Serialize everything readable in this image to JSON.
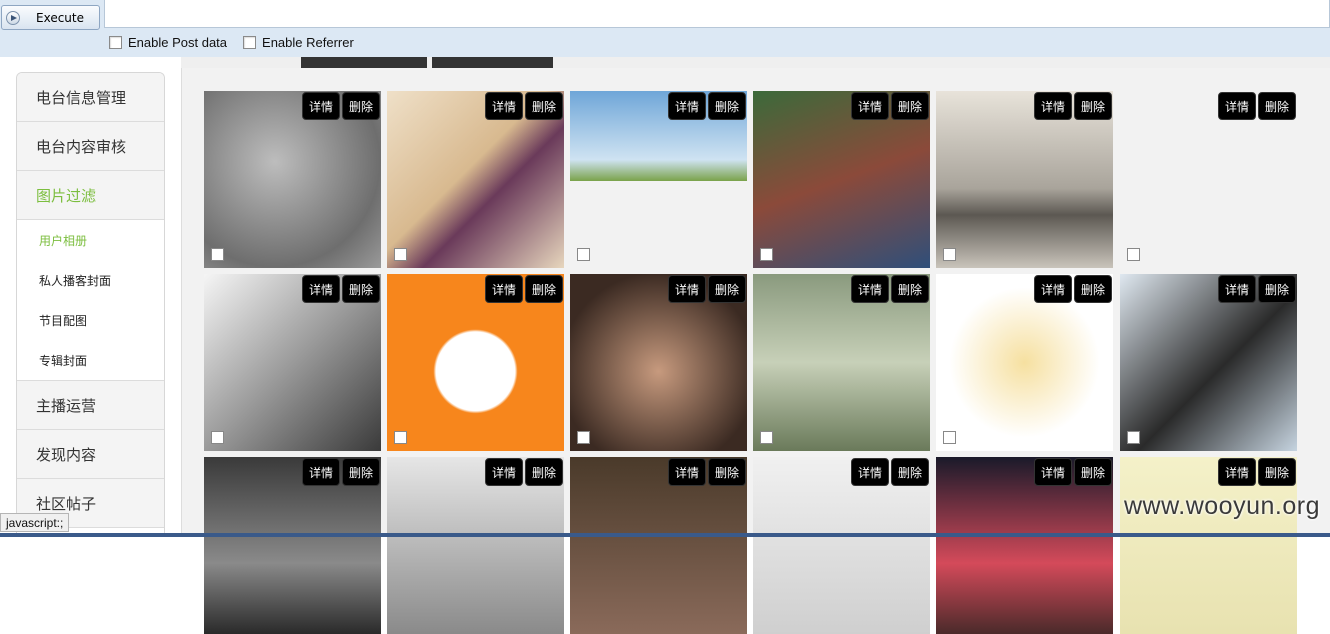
{
  "hackbar": {
    "execute_label": "Execute",
    "url_value": "",
    "options": [
      "Enable Post data",
      "Enable Referrer"
    ]
  },
  "sidebar": {
    "items_top": [
      "电台信息管理",
      "电台内容审核",
      "图片过滤"
    ],
    "sub_items": [
      "用户相册",
      "私人播客封面",
      "节目配图",
      "专辑封面"
    ],
    "items_bottom": [
      "主播运营",
      "发现内容",
      "社区帖子"
    ]
  },
  "grid": {
    "detail_label": "详情",
    "delete_label": "删除"
  },
  "status_text": "javascript:;",
  "watermark": "www.wooyun.org",
  "colors": {
    "active_green": "#7cbe3f",
    "toolbar_bg": "#dce8f4"
  }
}
